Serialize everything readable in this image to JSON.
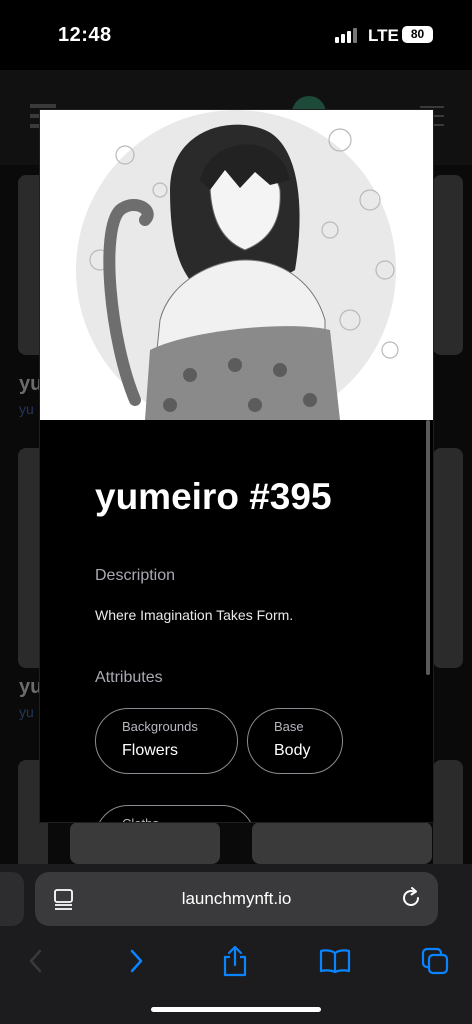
{
  "status_bar": {
    "time": "12:48",
    "network": "LTE",
    "battery": "80"
  },
  "background_page": {
    "card_title_1": "yu",
    "card_sub_1": "yu",
    "card_title_2": "yu",
    "card_sub_2": "yu"
  },
  "modal": {
    "title": "yumeiro #395",
    "description_label": "Description",
    "description": "Where Imagination Takes Form.",
    "attributes_label": "Attributes",
    "attributes": [
      {
        "key": "Backgrounds",
        "value": "Flowers"
      },
      {
        "key": "Base",
        "value": "Body"
      },
      {
        "key": "Cloths",
        "value": ""
      }
    ]
  },
  "address_bar": {
    "url": "launchmynft.io"
  },
  "toolbar": {
    "back_icon": "chevron-left-icon",
    "forward_icon": "chevron-right-icon",
    "share_icon": "share-icon",
    "bookmarks_icon": "book-icon",
    "tabs_icon": "tabs-icon"
  },
  "colors": {
    "accent": "#0a84ff",
    "pill_border": "#8b8b93",
    "modal_bg": "#000000"
  }
}
